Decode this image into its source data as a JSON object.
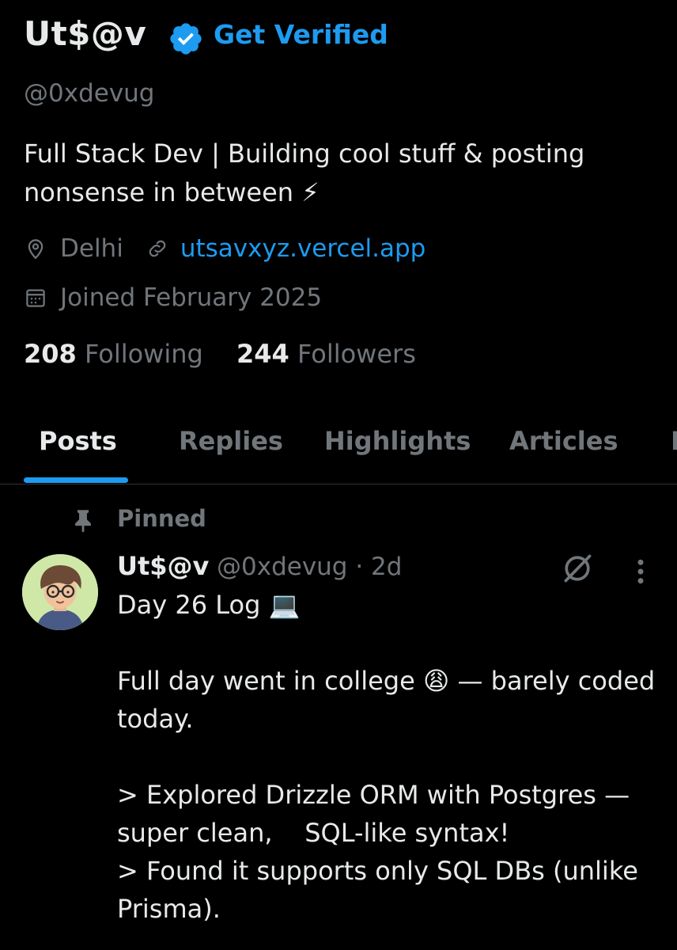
{
  "profile": {
    "display_name": "Ut$@v",
    "verified_cta": "Get Verified",
    "handle": "@0xdevug",
    "bio": "Full Stack Dev | Building cool stuff & posting nonsense in between ⚡",
    "location": "Delhi",
    "website": "utsavxyz.vercel.app",
    "joined": "Joined February 2025",
    "following_count": "208",
    "following_label": "Following",
    "followers_count": "244",
    "followers_label": "Followers"
  },
  "tabs": [
    {
      "label": "Posts",
      "active": true
    },
    {
      "label": "Replies",
      "active": false
    },
    {
      "label": "Highlights",
      "active": false
    },
    {
      "label": "Articles",
      "active": false
    },
    {
      "label": "M",
      "active": false
    }
  ],
  "pinned_post": {
    "pinned_label": "Pinned",
    "author": "Ut$@v",
    "handle_time": "@0xdevug · 2d",
    "body": "Day 26 Log 💻\n\nFull day went in college 😩 — barely coded today.\n\n> Explored Drizzle ORM with Postgres — super clean,    SQL-like syntax!\n> Found it supports only SQL DBs (unlike Prisma)."
  },
  "icons": {
    "verified": "verified-badge-icon",
    "location": "location-pin-icon",
    "link": "link-icon",
    "calendar": "calendar-icon",
    "pin": "pin-icon",
    "grok": "grok-icon",
    "more": "more-vertical-icon"
  },
  "colors": {
    "background": "#000000",
    "accent": "#1d9bf0",
    "primary_text": "#e7e9ea",
    "secondary_text": "#71767b"
  }
}
